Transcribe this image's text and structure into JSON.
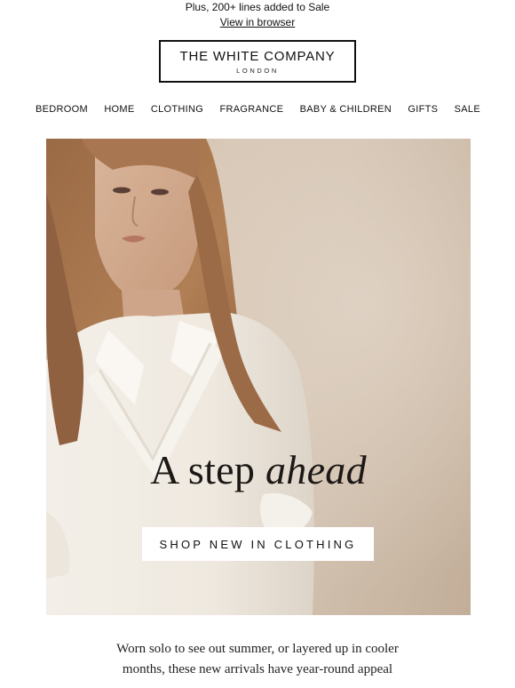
{
  "preheader": {
    "line1": "Plus, 200+ lines added to Sale",
    "view_in_browser": "View in browser"
  },
  "logo": {
    "brand": "THE WHITE COMPANY",
    "city": "LONDON"
  },
  "nav": {
    "items": [
      "BEDROOM",
      "HOME",
      "CLOTHING",
      "FRAGRANCE",
      "BABY & CHILDREN",
      "GIFTS",
      "SALE"
    ]
  },
  "hero": {
    "headline_plain": "A step ",
    "headline_italic": "ahead",
    "cta_label": "SHOP NEW IN CLOTHING"
  },
  "body": {
    "line1": "Worn solo to see out summer, or layered up in cooler",
    "line2": "months, these new arrivals have year-round appeal"
  },
  "colors": {
    "background": "#ffffff",
    "text": "#111111",
    "hero_backdrop": "#d3c3b2",
    "cta_background": "#ffffff"
  }
}
